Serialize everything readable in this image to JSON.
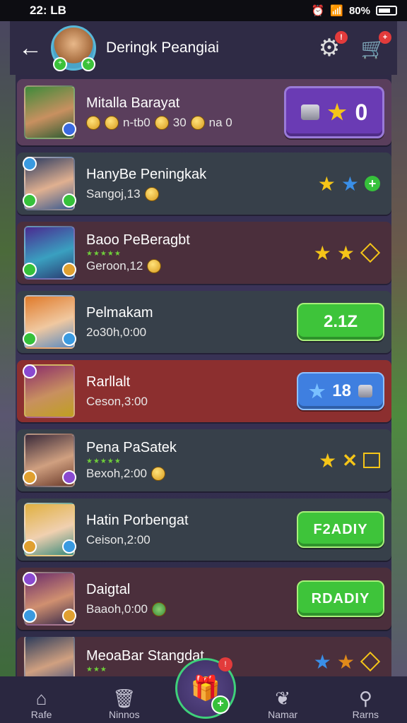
{
  "status_bar": {
    "time": "22: LB",
    "battery": "80%"
  },
  "header": {
    "title": "Deringk Peangiai"
  },
  "rows": [
    {
      "name": "Mitalla Barayat",
      "sub": "n-tb0",
      "sub2": "30",
      "sub3": "na 0",
      "action": "0"
    },
    {
      "name": "HanyBe Peningkak",
      "sub": "Sangoj,13"
    },
    {
      "name": "Baoo PeBeragbt",
      "sub": "Geroon,12"
    },
    {
      "name": "Pelmakam",
      "sub": "2o30h,0:00",
      "action": "2.1Z"
    },
    {
      "name": "Rarllalt",
      "sub": "Ceson,3:00",
      "action": "18"
    },
    {
      "name": "Pena PaSatek",
      "sub": "Bexoh,2:00"
    },
    {
      "name": "Hatin Porbengat",
      "sub": "Ceison,2:00",
      "action": "F2ADIY"
    },
    {
      "name": "Daigtal",
      "sub": "Baaoh,0:00",
      "action": "RDADIY"
    },
    {
      "name": "MeoaBar Stangdat",
      "sub": ""
    }
  ],
  "nav": {
    "home": "Rafe",
    "winners": "Ninnos",
    "center": "",
    "namar": "Namar",
    "harms": "Rarns"
  },
  "icons": [
    "back-arrow-icon",
    "gear-icon",
    "cart-icon",
    "star-icon",
    "chest-icon",
    "coin-icon",
    "home-icon",
    "cup-icon",
    "apple-icon",
    "search-icon"
  ],
  "colors": {
    "accent_green": "#3ec43a",
    "accent_blue": "#3f7fe0",
    "accent_purple": "#6a3bb4",
    "badge_red": "#e23b3b"
  }
}
